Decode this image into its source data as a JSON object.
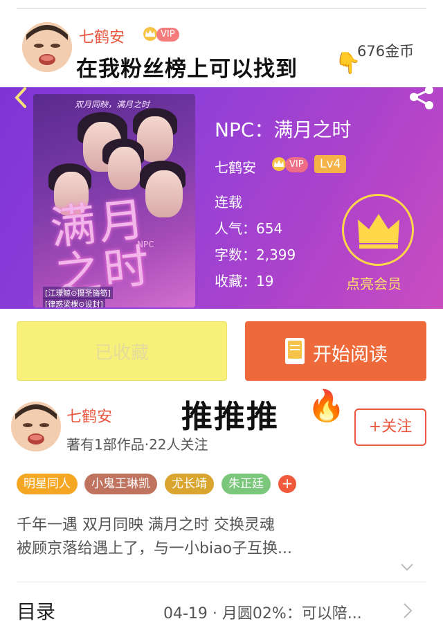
{
  "comment": {
    "user_name": "七鹤安",
    "vip_badge": "VIP",
    "text": "在我粉丝榜上可以找到",
    "emoji": "👇",
    "coins": "676金币"
  },
  "book": {
    "title": "NPC：满月之时",
    "author": "七鹤安",
    "vip_badge": "VIP",
    "level": "Lv4",
    "status": "连载",
    "popularity": "人气：654",
    "word_count": "字数：2,399",
    "favorites": "收藏：19",
    "member_label": "点亮会员",
    "cover": {
      "tagline": "双月同映，满月之时",
      "title": "满月之时",
      "sub": "NPC",
      "credit_1": "[江璟鲸⊙摄圣旖笱]",
      "credit_2": "[律惑梁棵⊙设封]"
    }
  },
  "actions": {
    "collected": "已收藏",
    "start_reading": "开始阅读"
  },
  "author": {
    "name": "七鹤安",
    "meta": "著有1部作品·22人关注",
    "follow": "+关注",
    "overlay_text": "推推推",
    "overlay_emoji": "🔥"
  },
  "tags": [
    {
      "label": "明星同人",
      "color": "#f5a623"
    },
    {
      "label": "小鬼王琳凯",
      "color": "#c0735f"
    },
    {
      "label": "尤长靖",
      "color": "#d9a52e"
    },
    {
      "label": "朱正廷",
      "color": "#7bc77b"
    }
  ],
  "tag_more": "+",
  "intro": {
    "line1": "千年一遇 双月同映 满月之时 交换灵魂",
    "line2": "被顾京落给遇上了，与一小biao子互换..."
  },
  "catalog": {
    "label": "目录",
    "latest": "04-19 · 月圆02%：可以陪..."
  },
  "colors": {
    "accent": "#e8573d",
    "header_purple": "#8f3fd8",
    "read_button": "#ef6a3b",
    "collected_button": "#f7f17a",
    "gold": "#ffd84a"
  }
}
